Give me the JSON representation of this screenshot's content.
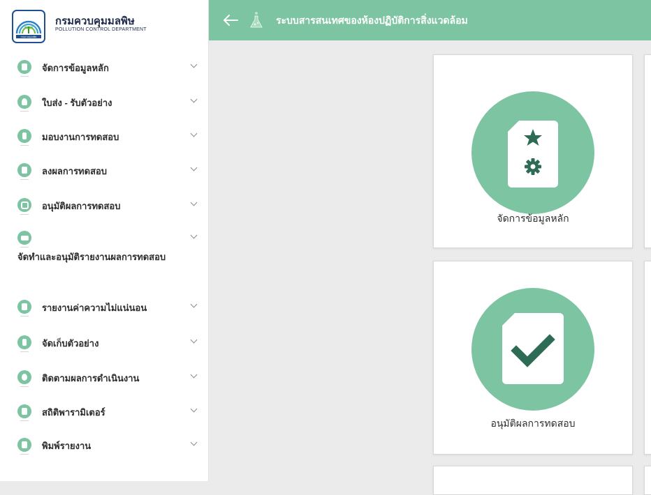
{
  "brand": {
    "title": "กรมควบคุมมลพิษ",
    "subtitle": "POLLUTION CONTROL DEPARTMENT",
    "logo_text": "กรมควบคุมมลพิษ"
  },
  "topbar": {
    "back_icon": "arrow-left-icon",
    "app_icon": "flask-icon",
    "title": "ระบบสารสนเทศของห้องปฏิบัติการสิ่งแวดล้อม"
  },
  "colors": {
    "accent": "#7dc4a2",
    "icon_dark": "#2e6b55",
    "background": "#ebebeb"
  },
  "sidebar": {
    "items": [
      {
        "label": "จัดการข้อมูลหลัก",
        "icon": "database-icon"
      },
      {
        "label": "ใบส่ง - รับตัวอย่าง",
        "icon": "user-icon"
      },
      {
        "label": "มอบงานการทดสอบ",
        "icon": "info-icon"
      },
      {
        "label": "ลงผลการทดสอบ",
        "icon": "document-icon"
      },
      {
        "label": "อนุมัติผลการทดสอบ",
        "icon": "check-icon"
      },
      {
        "label": "จัดทำและอนุมัติรายงานผลการทดสอบ",
        "icon": "printer-icon"
      },
      {
        "label": "รายงานค่าความไม่แน่นอน",
        "icon": "report-icon"
      },
      {
        "label": "จัดเก็บตัวอย่าง",
        "icon": "archive-icon"
      },
      {
        "label": "ติดตามผลการดำเนินงาน",
        "icon": "tracking-icon"
      },
      {
        "label": "สถิติพารามิเตอร์",
        "icon": "statistics-icon"
      },
      {
        "label": "พิมพ์รายงาน",
        "icon": "print-report-icon"
      }
    ]
  },
  "cards": [
    {
      "label": "จัดการข้อมูลหลัก",
      "icon": "document-star-gear-icon"
    },
    {
      "label": "อนุมัติผลการทดสอบ",
      "icon": "document-check-icon"
    }
  ]
}
